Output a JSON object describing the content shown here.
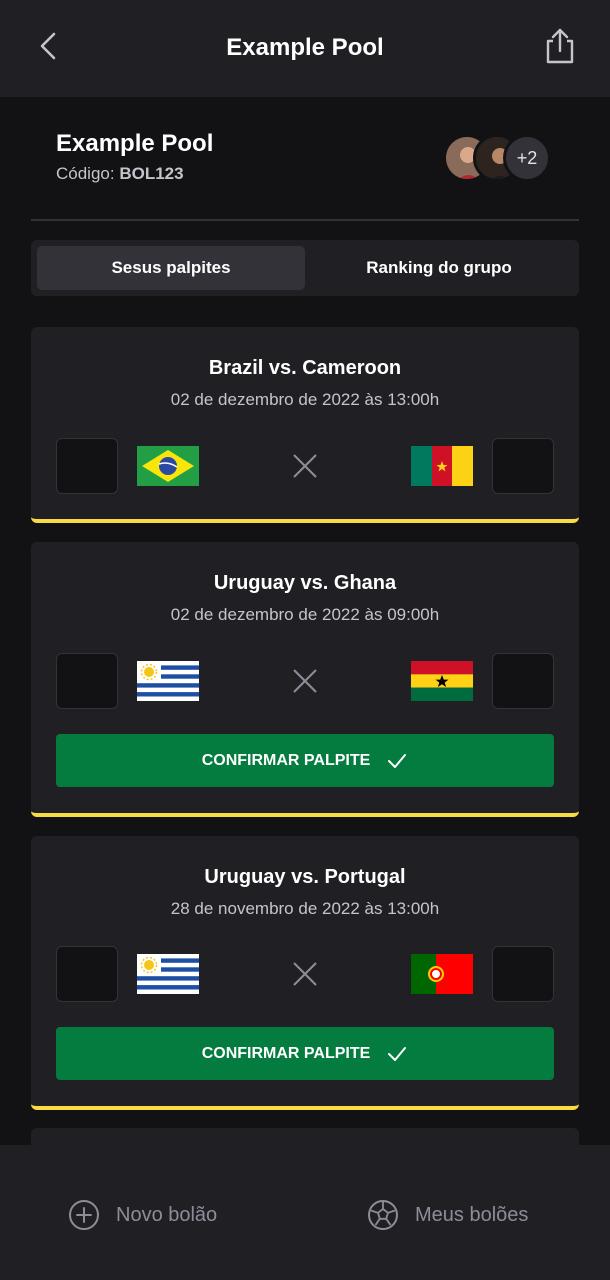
{
  "header": {
    "title": "Example Pool",
    "back_icon": "chevron-left-icon",
    "share_icon": "share-icon"
  },
  "pool": {
    "name": "Example Pool",
    "code_label": "Código:",
    "code": "BOL123",
    "extra_participants": "+2"
  },
  "tabs": [
    {
      "label": "Sesus palpites",
      "active": true
    },
    {
      "label": "Ranking do grupo",
      "active": false
    }
  ],
  "matches": [
    {
      "title": "Brazil vs. Cameroon",
      "date": "02 de dezembro de 2022 às 13:00h",
      "home_flag": "brazil-flag",
      "away_flag": "cameroon-flag",
      "show_confirm": false
    },
    {
      "title": "Uruguay vs. Ghana",
      "date": "02 de dezembro de 2022 às 09:00h",
      "home_flag": "uruguay-flag",
      "away_flag": "ghana-flag",
      "show_confirm": true,
      "confirm_label": "CONFIRMAR PALPITE"
    },
    {
      "title": "Uruguay vs. Portugal",
      "date": "28 de novembro de 2022 às 13:00h",
      "home_flag": "uruguay-flag",
      "away_flag": "portugal-flag",
      "show_confirm": true,
      "confirm_label": "CONFIRMAR PALPITE"
    }
  ],
  "bottom_nav": {
    "new_pool": "Novo bolão",
    "my_pools": "Meus bolões"
  },
  "colors": {
    "background": "#121214",
    "surface": "#202024",
    "accent_yellow": "#f7dd43",
    "button_green": "#047c3f",
    "text_muted": "#8d8d99"
  }
}
